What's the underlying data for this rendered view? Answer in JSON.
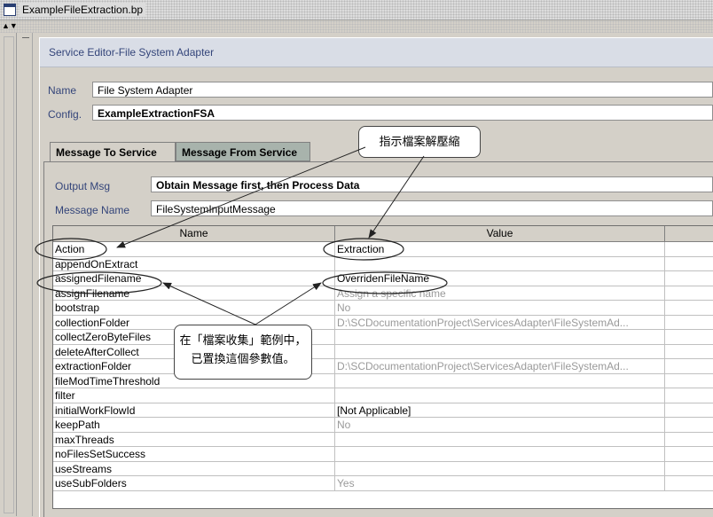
{
  "window": {
    "title": "ExampleFileExtraction.bp"
  },
  "panel": {
    "title": "Service Editor-File System Adapter"
  },
  "form": {
    "name_label": "Name",
    "name_value": "File System Adapter",
    "config_label": "Config.",
    "config_value": "ExampleExtractionFSA"
  },
  "tabs": [
    {
      "label": "Message To Service",
      "active": true
    },
    {
      "label": "Message From Service",
      "active": false
    }
  ],
  "message": {
    "output_label": "Output Msg",
    "output_value": "Obtain Message first, then Process Data",
    "name_label": "Message Name",
    "name_value": "FileSystemInputMessage"
  },
  "table": {
    "columns": [
      "Name",
      "Value"
    ],
    "rows": [
      {
        "name": "Action",
        "value": "Extraction",
        "grey": false
      },
      {
        "name": "appendOnExtract",
        "value": "",
        "grey": false
      },
      {
        "name": "assignedFilename",
        "value": "OverridenFileName",
        "grey": false
      },
      {
        "name": "assignFilename",
        "value": "Assign a specific name",
        "grey": true
      },
      {
        "name": "bootstrap",
        "value": "No",
        "grey": true
      },
      {
        "name": "collectionFolder",
        "value": "D:\\SCDocumentationProject\\ServicesAdapter\\FileSystemAd...",
        "grey": true
      },
      {
        "name": "collectZeroByteFiles",
        "value": "",
        "grey": false
      },
      {
        "name": "deleteAfterCollect",
        "value": "",
        "grey": false
      },
      {
        "name": "extractionFolder",
        "value": "D:\\SCDocumentationProject\\ServicesAdapter\\FileSystemAd...",
        "grey": true
      },
      {
        "name": "fileModTimeThreshold",
        "value": "",
        "grey": false
      },
      {
        "name": "filter",
        "value": "",
        "grey": false
      },
      {
        "name": "initialWorkFlowId",
        "value": "[Not Applicable]",
        "grey": false
      },
      {
        "name": "keepPath",
        "value": "No",
        "grey": true
      },
      {
        "name": "maxThreads",
        "value": "",
        "grey": false
      },
      {
        "name": "noFilesSetSuccess",
        "value": "",
        "grey": false
      },
      {
        "name": "useStreams",
        "value": "",
        "grey": false
      },
      {
        "name": "useSubFolders",
        "value": "Yes",
        "grey": true
      }
    ]
  },
  "callouts": {
    "top": "指示檔案解壓縮",
    "middle_line1": "在「檔案收集」範例中，",
    "middle_line2": "已置換這個參數值。"
  }
}
